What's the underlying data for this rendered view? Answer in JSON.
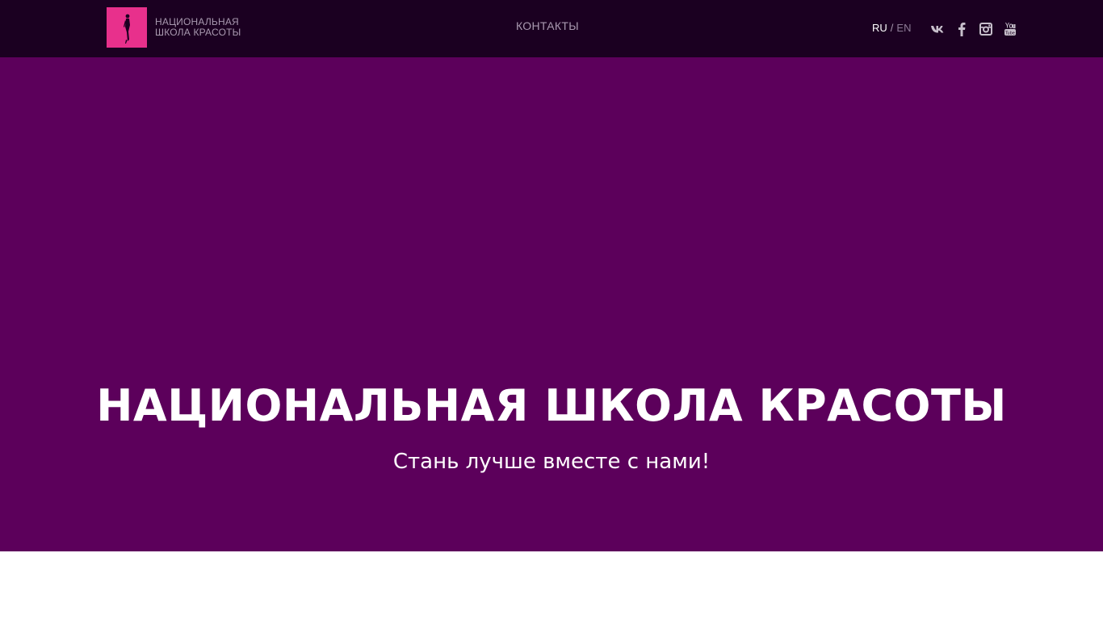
{
  "header": {
    "logo": {
      "line1": "НАЦИОНАЛЬНАЯ",
      "line2": "ШКОЛА КРАСОТЫ",
      "icon": "woman-silhouette-icon"
    },
    "nav": {
      "contacts_label": "КОНТАКТЫ"
    },
    "language": {
      "ru_label": "RU",
      "separator": "/",
      "en_label": "EN",
      "active": "RU"
    },
    "socials": [
      {
        "name": "vk-icon"
      },
      {
        "name": "facebook-icon"
      },
      {
        "name": "instagram-icon"
      },
      {
        "name": "youtube-icon"
      }
    ]
  },
  "hero": {
    "title": "НАЦИОНАЛЬНАЯ ШКОЛА КРАСОТЫ",
    "subtitle": "Стань лучше вместе с нами!"
  },
  "colors": {
    "header_bg": "#1b0021",
    "hero_bg": "#5c005b",
    "logo_bg": "#e8308c",
    "muted_text": "#a99ab0"
  }
}
